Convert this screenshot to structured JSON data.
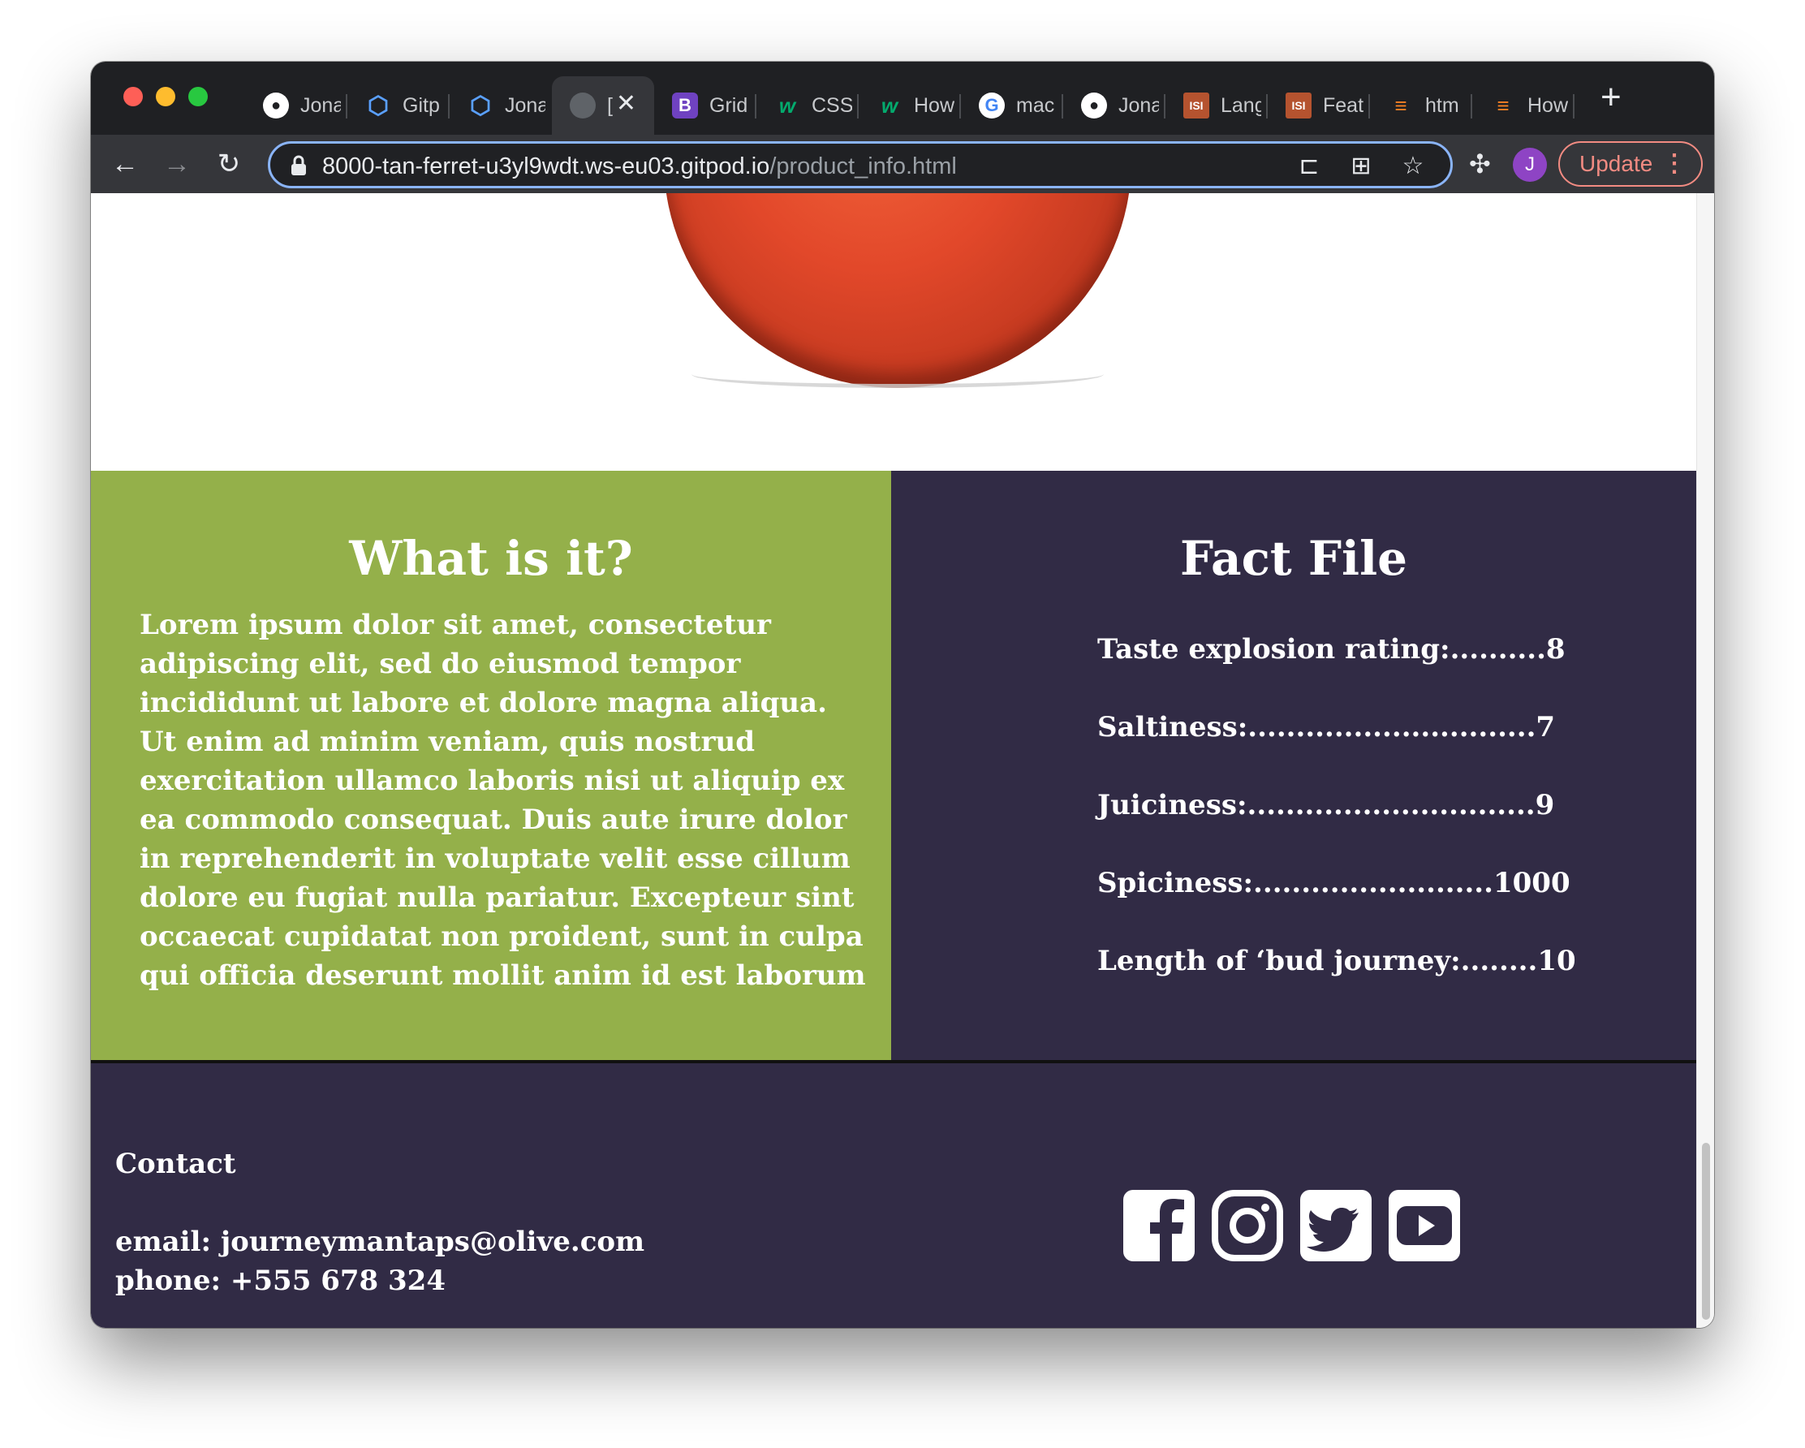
{
  "browser": {
    "tabs": [
      {
        "icon": "github-icon",
        "label": "Jona"
      },
      {
        "icon": "gitpod-icon",
        "label": "Gitp"
      },
      {
        "icon": "gitpod-icon",
        "label": "Jona"
      },
      {
        "icon": "globe-icon",
        "label": "[",
        "active": true
      },
      {
        "icon": "bootstrap-icon",
        "label": "Grid"
      },
      {
        "icon": "w3schools-icon",
        "label": "CSS"
      },
      {
        "icon": "w3schools-icon",
        "label": "How"
      },
      {
        "icon": "google-icon",
        "label": "mac"
      },
      {
        "icon": "github-icon",
        "label": "Jona"
      },
      {
        "icon": "lang-icon",
        "label": "Lang"
      },
      {
        "icon": "lang-icon",
        "label": "Feat"
      },
      {
        "icon": "stackoverflow-icon",
        "label": "htm"
      },
      {
        "icon": "stackoverflow-icon",
        "label": "How"
      }
    ],
    "url_host": "8000-tan-ferret-u3yl9wdt.ws-eu03.gitpod.io",
    "url_path": "/product_info.html",
    "avatar_letter": "J",
    "update_label": "Update"
  },
  "page": {
    "what_title": "What is it?",
    "what_body": "Lorem ipsum dolor sit amet, consectetur adipiscing elit, sed do eiusmod tempor incididunt ut labore et dolore magna aliqua. Ut enim ad minim veniam, quis nostrud exercitation ullamco laboris nisi ut aliquip ex ea commodo consequat. Duis aute irure dolor in reprehenderit in voluptate velit esse cillum dolore eu fugiat nulla pariatur. Excepteur sint occaecat cupidatat non proident, sunt in culpa qui officia deserunt mollit anim id est laborum",
    "fact_title": "Fact File",
    "facts": [
      "Taste explosion rating:..........8",
      "Saltiness:..............................7",
      "Juiciness:..............................9",
      "Spiciness:.........................1000",
      "Length of ‘bud journey:........10"
    ]
  },
  "footer": {
    "contact_heading": "Contact",
    "email": "email: journeymantaps@olive.com",
    "phone": "phone: +555 678 324",
    "socials": [
      "facebook-icon",
      "instagram-icon",
      "twitter-icon",
      "youtube-icon"
    ]
  },
  "colors": {
    "what_panel_bg": "#94b04a",
    "fact_panel_bg": "#312b45",
    "footer_bg": "#312b45"
  }
}
